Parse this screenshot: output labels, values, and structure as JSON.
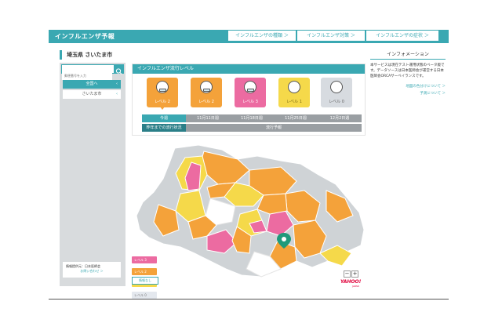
{
  "header": {
    "title": "インフルエンザ予報",
    "nav": [
      "インフルエンザの種類 ＞",
      "インフルエンザ対策 ＞",
      "インフルエンザの症状 ＞"
    ]
  },
  "page": {
    "title": "埼玉県 さいたま市"
  },
  "sidebar": {
    "search_placeholder": "郵便番号を入力",
    "items": [
      {
        "label": "全国へ",
        "chevron": "‹"
      },
      {
        "label": "さいたま市",
        "chevron": "‹"
      }
    ],
    "provider": "情報提供元：日本医師会",
    "contact": "お問い合わせ ＞"
  },
  "panel": {
    "title": "インフルエンザ流行レベル",
    "levels": [
      {
        "label": "レベル 2",
        "color": "#f4a23a"
      },
      {
        "label": "レベル 2",
        "color": "#f4a23a"
      },
      {
        "label": "レベル 3",
        "color": "#ec6ba1"
      },
      {
        "label": "レベル 1",
        "color": "#f5d94a"
      },
      {
        "label": "レベル 0",
        "color": "#d7dbe0"
      }
    ],
    "weeks": [
      "今週",
      "11月11日週",
      "11月18日週",
      "11月25日週",
      "12月2日週"
    ],
    "status_left": "昨年までの流行状況",
    "status_right": "流行予報"
  },
  "legend": [
    {
      "label": "レベル 3",
      "color": "#ec6ba1"
    },
    {
      "label": "レベル 2",
      "color": "#f4a23a"
    },
    {
      "label": "レベル 1",
      "color": "#f5d94a"
    },
    {
      "label": "レベル 0",
      "color": "#d7dbe0"
    },
    {
      "label": "情報なし",
      "color": "#ffffff"
    }
  ],
  "map": {
    "zoom_out": "−",
    "zoom_in": "+",
    "brand": "YAHOO!",
    "brand_sub": "JAPAN",
    "marker_icon": "location-pin-icon"
  },
  "info": {
    "title": "インフォメーション",
    "body": "本サービスは現在テスト運用状態のベータ版です。データソースは日本医師会が運営する日本医師会ORCAサーベイランスです。",
    "links": [
      "地図の色分けについて ＞",
      "予測について ＞"
    ]
  }
}
